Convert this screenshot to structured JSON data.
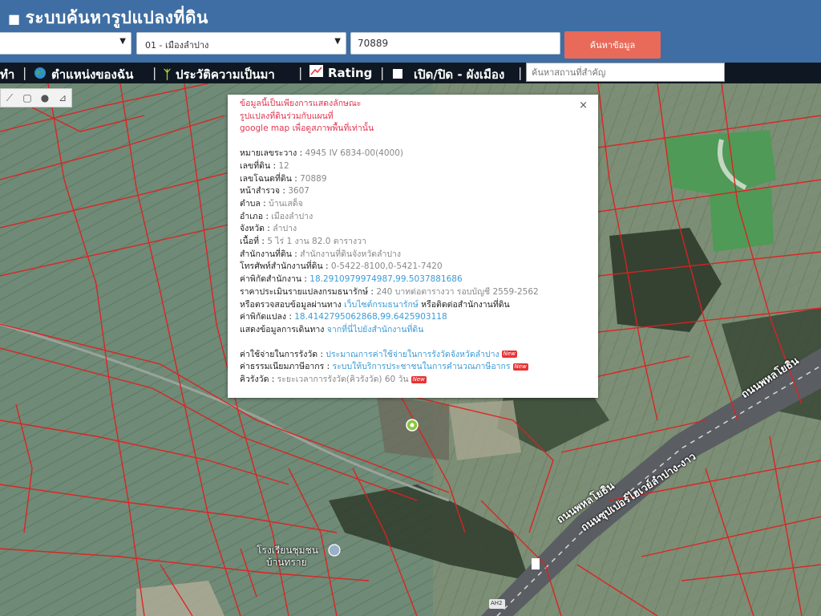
{
  "header": {
    "title": "ระบบค้นหารูปแปลงที่ดิน",
    "province_value": "",
    "district_value": "01 - เมืองลำปาง",
    "parcel_value": "70889",
    "search_label": "ค้นหาข้อมูล",
    "colors": {
      "bar": "#3e6ea3",
      "button": "#e96a59"
    }
  },
  "toolbar": {
    "item1": "ทำ",
    "my_location": "ตำแหน่งของฉัน",
    "history": "ประวัติความเป็นมา",
    "rating": "Rating",
    "toggle_plan": "เปิด/ปิด - ผังเมือง",
    "place_search_placeholder": "ค้นหาสถานที่สำคัญ",
    "icons": [
      "globe-icon",
      "sprout-icon",
      "chart-icon",
      "square-icon"
    ]
  },
  "popup": {
    "warning_1": "ข้อมูลนี้เป็นเพียงการแสดงลักษณะ",
    "warning_2": "รูปแปลงที่ดินร่วมกับแผนที่",
    "warning_3a": "google map",
    "warning_3b": " เพื่อดูสภาพพื้นที่เท่านั้น",
    "fields": [
      {
        "label": "หมายเลขระวาง : ",
        "value": "4945 IV 6834-00(4000)"
      },
      {
        "label": "เลขที่ดิน : ",
        "value": "12"
      },
      {
        "label": "เลขโฉนดที่ดิน : ",
        "value": "70889"
      },
      {
        "label": "หน้าสำรวจ : ",
        "value": "3607"
      },
      {
        "label": "ตำบล : ",
        "value": "บ้านเสด็จ"
      },
      {
        "label": "อำเภอ : ",
        "value": "เมืองลำปาง"
      },
      {
        "label": "จังหวัด : ",
        "value": "ลำปาง"
      }
    ],
    "area_label": "เนื้อที่ : ",
    "area_value": "5 ไร่ 1 งาน 82.0 ตารางวา",
    "office_label": "สำนักงานที่ดิน : ",
    "office_value": "สำนักงานที่ดินจังหวัดลำปาง",
    "phone_label": "โทรศัพท์สำนักงานที่ดิน : ",
    "phone_value": "0-5422-8100,0-5421-7420",
    "office_coord_label": "ค่าพิกัดสำนักงาน : ",
    "office_coord_value": "18.2910979974987,99.5037881686",
    "price_label": "ราคาประเมินรายแปลงกรมธนารักษ์ : ",
    "price_value": "240 บาทต่อตารางวา รอบบัญชี 2559-2562",
    "check_prefix": "หรือตรวจสอบข้อมูลผ่านทาง ",
    "check_link": "เว็บไซต์กรมธนารักษ์",
    "check_suffix": " หรือติดต่อสำนักงานที่ดิน",
    "parcel_coord_label": "ค่าพิกัดแปลง : ",
    "parcel_coord_value": "18.4142795062868,99.6425903118",
    "route_label": "แสดงข้อมูลการเดินทาง ",
    "route_link": "จากที่นี่ไปยังสำนักงานที่ดิน",
    "fee_label": "ค่าใช้จ่ายในการรังวัด : ",
    "fee_link": "ประมาณการค่าใช้จ่ายในการรังวัดจังหวัดลำปาง",
    "tax_label": "ค่าธรรมเนียมภาษีอากร : ",
    "tax_link": "ระบบให้บริการประชาชนในการคำนวณภาษีอากร",
    "queue_label": "คิวรังวัด : ",
    "queue_value": "ระยะเวลาการรังวัด(คิวรังวัด) 60 วัน",
    "new_badge": "New",
    "close_symbol": "×"
  },
  "map": {
    "road_label_1": "ถนนพหลโยธิน",
    "road_label_2": "ถนนซุปเปอร์ไฮเวย์ลำปาง-งาว",
    "road_label_3": "ถนนพหลโยธิน",
    "school_label_1": "โรงเรียนชุมชน",
    "school_label_2": "บ้านทราย",
    "route_shield": "AH2",
    "colors": {
      "parcel_line": "#e02020",
      "road": "#5a5e63"
    }
  }
}
